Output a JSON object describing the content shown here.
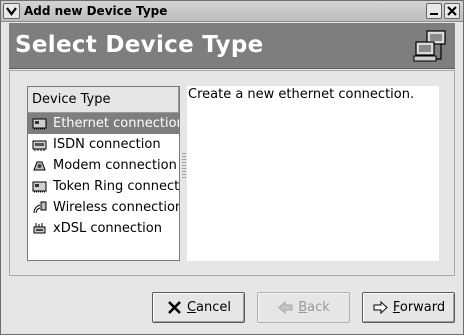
{
  "window": {
    "title": "Add new Device Type"
  },
  "header": {
    "title": "Select Device Type",
    "icon": "network-computers-icon"
  },
  "device_list": {
    "column_header": "Device Type",
    "items": [
      {
        "label": "Ethernet connection",
        "icon": "ethernet-card-icon",
        "selected": true
      },
      {
        "label": "ISDN connection",
        "icon": "isdn-card-icon",
        "selected": false
      },
      {
        "label": "Modem connection",
        "icon": "modem-icon",
        "selected": false
      },
      {
        "label": "Token Ring connection",
        "icon": "token-ring-card-icon",
        "selected": false
      },
      {
        "label": "Wireless connection",
        "icon": "wireless-icon",
        "selected": false
      },
      {
        "label": "xDSL connection",
        "icon": "xdsl-icon",
        "selected": false
      }
    ]
  },
  "description": {
    "text": "Create a new ethernet connection."
  },
  "buttons": {
    "cancel": {
      "mnemonic": "C",
      "rest": "ancel",
      "icon": "x-icon",
      "enabled": true
    },
    "back": {
      "mnemonic": "B",
      "rest": "ack",
      "icon": "left-arrow-icon",
      "enabled": false
    },
    "forward": {
      "mnemonic": "F",
      "rest": "orward",
      "icon": "right-arrow-icon",
      "enabled": true
    }
  }
}
